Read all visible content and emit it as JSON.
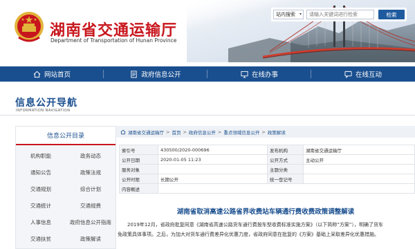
{
  "header": {
    "title": "湖南省交通运输厅",
    "subtitle": "Department of Transportation of Hunan Province",
    "search": {
      "scope": "站内搜索",
      "placeholder": "请输入关键词进行检索",
      "button": "检索"
    }
  },
  "nav": [
    {
      "label": "网站首页",
      "icon": "home-icon"
    },
    {
      "label": "政府信息公开",
      "icon": "document-icon"
    },
    {
      "label": "在线办事",
      "icon": "computer-icon"
    },
    {
      "label": "在线互动",
      "icon": "chat-icon"
    }
  ],
  "section": {
    "title": "信息公开导航",
    "subtitle": "INFORMATION NAVIGATION"
  },
  "sidebar": {
    "heading": "信息公开目录",
    "rows": [
      [
        "机构职能",
        "政务动态"
      ],
      [
        "通知公告",
        "政策法规"
      ],
      [
        "交通规划",
        "综合计划"
      ],
      [
        "交通统计",
        "交通规费"
      ],
      [
        "人事信息",
        "政府信息公开指南"
      ],
      [
        "交通扶贫",
        "政策解读"
      ]
    ]
  },
  "breadcrumb": [
    "湖南省交通运输厅",
    "首页",
    "政府信息公开",
    "重点领域信息公开",
    "政策解读"
  ],
  "info_table": {
    "rows": [
      [
        {
          "k": "索引号",
          "v": "430500/2020-000696"
        },
        {
          "k": "发布机构",
          "v": "湖南省交通运输厅"
        }
      ],
      [
        {
          "k": "公开日期",
          "v": "2020-01-05 11:23"
        },
        {
          "k": "公开方式",
          "v": "主动公开"
        }
      ],
      [
        {
          "k": "服务对象",
          "v": ""
        },
        {
          "k": "主题分类",
          "v": ""
        }
      ],
      [
        {
          "k": "公开时限",
          "v": "长期公开"
        },
        {
          "k": "统一登记号",
          "v": ""
        }
      ],
      [
        {
          "k": "内容概述",
          "v": ""
        },
        {
          "k": "",
          "v": ""
        }
      ]
    ]
  },
  "article": {
    "title": "湖南省取消高速公路省界收费站车辆通行费收费政策调整解读",
    "paragraphs": [
      "2019年12月，省政府批复同意《湖南省高速公路货车通行费按车型收费标准实施方案》（以下简称“方案”），明确了货车",
      "免政策具体事项。之后，为加大对货车通行费差异化优惠力度，省政府同意在批复的《方案》基础上采取差异化优惠措施。"
    ]
  },
  "colors": {
    "brand_red": "#c8161d",
    "nav_blue": "#1a4f8f"
  }
}
